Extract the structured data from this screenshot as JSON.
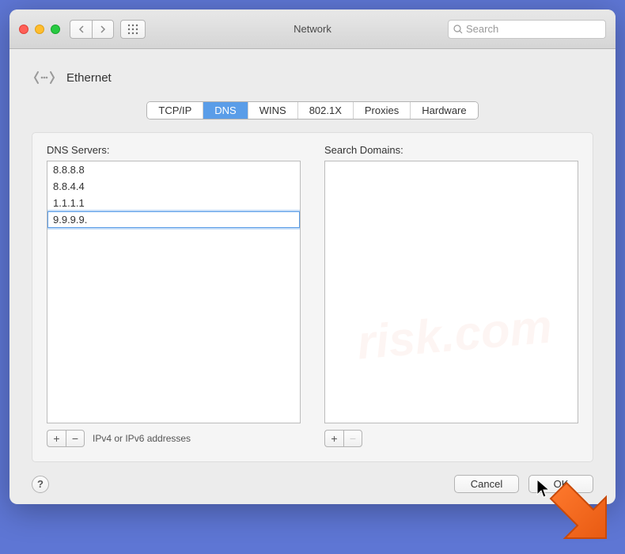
{
  "window": {
    "title": "Network",
    "search_placeholder": "Search"
  },
  "header": {
    "title": "Ethernet"
  },
  "tabs": [
    {
      "label": "TCP/IP",
      "active": false
    },
    {
      "label": "DNS",
      "active": true
    },
    {
      "label": "WINS",
      "active": false
    },
    {
      "label": "802.1X",
      "active": false
    },
    {
      "label": "Proxies",
      "active": false
    },
    {
      "label": "Hardware",
      "active": false
    }
  ],
  "dns": {
    "label": "DNS Servers:",
    "items": [
      "8.8.8.8",
      "8.8.4.4",
      "1.1.1.1",
      "9.9.9.9."
    ],
    "editing_index": 3,
    "hint": "IPv4 or IPv6 addresses"
  },
  "search_domains": {
    "label": "Search Domains:",
    "items": []
  },
  "buttons": {
    "plus": "+",
    "minus": "−",
    "help": "?",
    "cancel": "Cancel",
    "ok": "OK"
  }
}
